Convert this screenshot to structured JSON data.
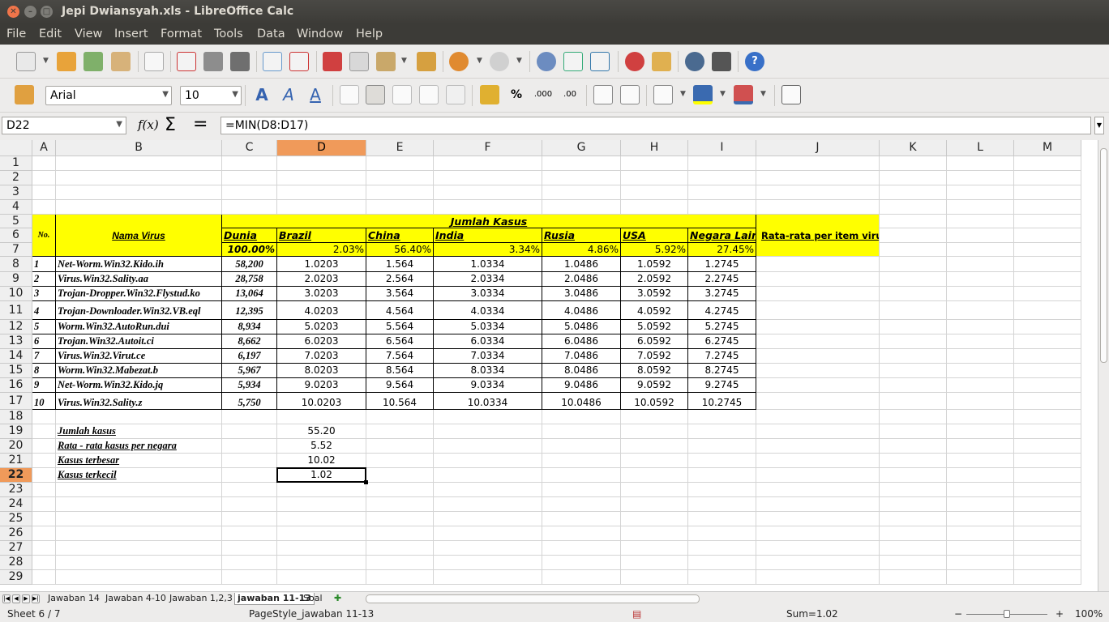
{
  "window": {
    "title": "Jepi Dwiansyah.xls - LibreOffice Calc"
  },
  "menu": [
    "File",
    "Edit",
    "View",
    "Insert",
    "Format",
    "Tools",
    "Data",
    "Window",
    "Help"
  ],
  "toolbar": {
    "font_name": "Arial",
    "font_size": "10"
  },
  "formula_bar": {
    "cell_ref": "D22",
    "formula": "=MIN(D8:D17)",
    "fx": "f(x)",
    "sigma": "Σ",
    "equals": "="
  },
  "columns": [
    "A",
    "B",
    "C",
    "D",
    "E",
    "F",
    "G",
    "H",
    "I",
    "J",
    "K",
    "L",
    "M"
  ],
  "rows": [
    "1",
    "2",
    "3",
    "4",
    "5",
    "6",
    "7",
    "8",
    "9",
    "10",
    "11",
    "12",
    "13",
    "14",
    "15",
    "16",
    "17",
    "18",
    "19",
    "20",
    "21",
    "22",
    "23",
    "24",
    "25",
    "26",
    "27",
    "28",
    "29"
  ],
  "table": {
    "header_jumlah": "Jumlah Kasus",
    "header_no": "No.",
    "header_nama": "Nama Virus",
    "header_rata": "Rata-rata per item virus",
    "countries": [
      "Dunia",
      "Brazil",
      "China",
      "India",
      "Rusia",
      "USA",
      "Negara Lain"
    ],
    "percents": [
      "100.00%",
      "2.03%",
      "56.40%",
      "3.34%",
      "4.86%",
      "5.92%",
      "27.45%"
    ],
    "data": [
      [
        "1",
        "Net-Worm.Win32.Kido.ih",
        "58,200",
        "1.0203",
        "1.564",
        "1.0334",
        "1.0486",
        "1.0592",
        "1.2745"
      ],
      [
        "2",
        "Virus.Win32.Sality.aa",
        "28,758",
        "2.0203",
        "2.564",
        "2.0334",
        "2.0486",
        "2.0592",
        "2.2745"
      ],
      [
        "3",
        "Trojan-Dropper.Win32.Flystud.ko",
        "13,064",
        "3.0203",
        "3.564",
        "3.0334",
        "3.0486",
        "3.0592",
        "3.2745"
      ],
      [
        "4",
        "Trojan-Downloader.Win32.VB.eql",
        "12,395",
        "4.0203",
        "4.564",
        "4.0334",
        "4.0486",
        "4.0592",
        "4.2745"
      ],
      [
        "5",
        "Worm.Win32.AutoRun.dui",
        "8,934",
        "5.0203",
        "5.564",
        "5.0334",
        "5.0486",
        "5.0592",
        "5.2745"
      ],
      [
        "6",
        "Trojan.Win32.Autoit.ci",
        "8,662",
        "6.0203",
        "6.564",
        "6.0334",
        "6.0486",
        "6.0592",
        "6.2745"
      ],
      [
        "7",
        "Virus.Win32.Virut.ce",
        "6,197",
        "7.0203",
        "7.564",
        "7.0334",
        "7.0486",
        "7.0592",
        "7.2745"
      ],
      [
        "8",
        "Worm.Win32.Mabezat.b",
        "5,967",
        "8.0203",
        "8.564",
        "8.0334",
        "8.0486",
        "8.0592",
        "8.2745"
      ],
      [
        "9",
        "Net-Worm.Win32.Kido.jq",
        "5,934",
        "9.0203",
        "9.564",
        "9.0334",
        "9.0486",
        "9.0592",
        "9.2745"
      ],
      [
        "10",
        "Virus.Win32.Sality.z",
        "5,750",
        "10.0203",
        "10.564",
        "10.0334",
        "10.0486",
        "10.0592",
        "10.2745"
      ]
    ],
    "summary": [
      {
        "label": "Jumlah kasus",
        "value": "55.20"
      },
      {
        "label": "Rata - rata kasus per negara",
        "value": "5.52"
      },
      {
        "label": "Kasus terbesar",
        "value": "10.02"
      },
      {
        "label": "Kasus terkecil",
        "value": "1.02"
      }
    ]
  },
  "sheet_tabs": [
    "Jawaban 14",
    "Jawaban 4-10",
    "Jawaban 1,2,3",
    "jawaban 11-13",
    "Soal"
  ],
  "active_tab_index": 3,
  "status": {
    "sheet": "Sheet 6 / 7",
    "pagestyle": "PageStyle_jawaban 11-13",
    "sum": "Sum=1.02",
    "zoom": "100%"
  },
  "colors": {
    "selection": "#f09a5a",
    "highlight": "#ffff00",
    "titlebar": "#3c3b37",
    "close": "#f0754a"
  }
}
